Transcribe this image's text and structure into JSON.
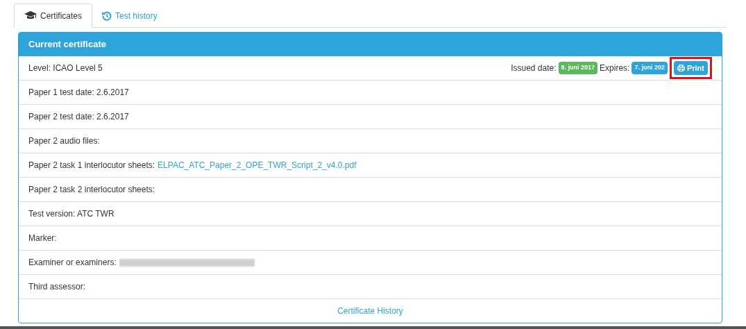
{
  "tabs": [
    {
      "label": "Certificates",
      "kind": "certificates",
      "selected": true
    },
    {
      "label": "Test history",
      "kind": "history",
      "selected": false
    }
  ],
  "panel": {
    "title": "Current certificate",
    "level_row": {
      "text": "Level: ICAO Level 5",
      "issued_label": "Issued date:",
      "issued": "8. juni 2017",
      "expires_label": "Expires:",
      "expires": "7. juni 202",
      "print": {
        "label": "Print",
        "highlighted": true
      }
    },
    "rows": [
      {
        "label": "Paper 1 test date: 2.6.2017"
      },
      {
        "label": "Paper 2 test date: 2.6.2017"
      },
      {
        "label": "Paper 2 audio files:"
      },
      {
        "label": "Paper 2 task 1 interlocutor sheets:",
        "link": "ELPAC_ATC_Paper_2_OPE_TWR_Script_2_v4.0.pdf"
      },
      {
        "label": "Paper 2 task 2 interlocutor sheets:"
      },
      {
        "label": "Test version: ATC TWR"
      },
      {
        "label": "Marker:"
      },
      {
        "label": "Examiner or examiners:",
        "redacted": true
      },
      {
        "label": "Third assessor:"
      }
    ],
    "footer_link": "Certificate History"
  }
}
